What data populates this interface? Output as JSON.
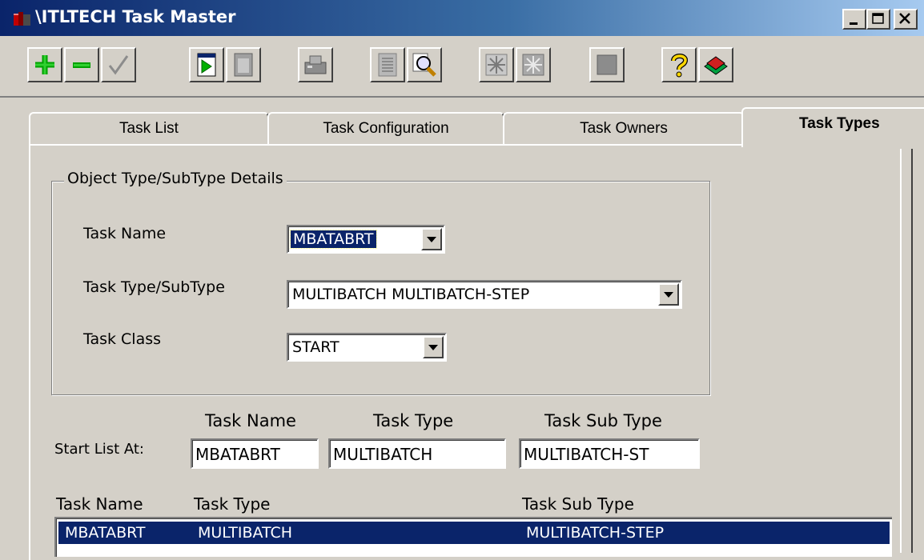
{
  "window": {
    "title": "\\ITLTECH Task Master"
  },
  "toolbar": {
    "buttons": [
      "add-icon",
      "remove-icon",
      "check-icon",
      "run-document-icon",
      "document-icon",
      "print-icon",
      "report-icon",
      "search-icon",
      "freeze-icon",
      "unfreeze-icon",
      "stop-icon",
      "help-icon",
      "exit-icon"
    ]
  },
  "tabs": [
    {
      "label": "Task List"
    },
    {
      "label": "Task Configuration"
    },
    {
      "label": "Task Owners"
    },
    {
      "label": "Task Types",
      "active": true
    }
  ],
  "details": {
    "group_title": "Object Type/SubType Details",
    "task_name_label": "Task Name",
    "task_name_value": "MBATABRT",
    "task_type_label": "Task Type/SubType",
    "task_type_value": "MULTIBATCH MULTIBATCH-STEP",
    "task_class_label": "Task Class",
    "task_class_value": "START"
  },
  "start_list": {
    "label": "Start List At:",
    "col_task_name": "Task Name",
    "col_task_type": "Task Type",
    "col_task_sub_type": "Task Sub Type",
    "task_name": "MBATABRT",
    "task_type": "MULTIBATCH",
    "task_sub_type": "MULTIBATCH-ST"
  },
  "list": {
    "headers": [
      "Task Name",
      "Task Type",
      "Task Sub Type"
    ],
    "rows": [
      {
        "task_name": "MBATABRT",
        "task_type": "MULTIBATCH",
        "task_sub_type": "MULTIBATCH-STEP",
        "selected": true
      }
    ]
  },
  "colors": {
    "selection": "#0a246a",
    "face": "#d4d0c8",
    "title_start": "#0a246a",
    "title_end": "#a6caf0"
  }
}
